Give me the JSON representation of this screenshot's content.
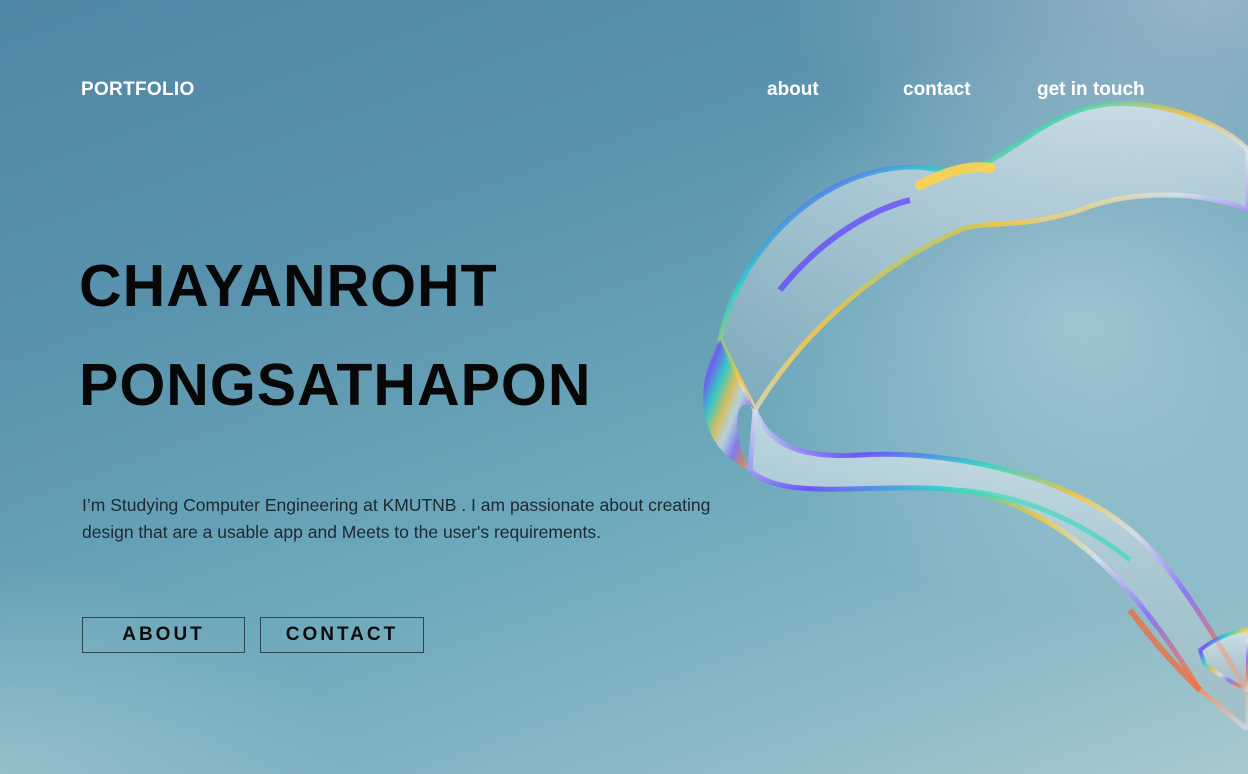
{
  "nav": {
    "logo": "PORTFOLIO",
    "links": [
      "about",
      "contact",
      "get in touch"
    ]
  },
  "hero": {
    "first_name": "CHAYANROHT",
    "last_name": "PONGSATHAPON",
    "description": "I’m Studying Computer Engineering at KMUTNB . I am passionate about creating design that are a usable app and Meets to the user's requirements.",
    "buttons": {
      "about": "ABOUT",
      "contact": "CONTACT"
    }
  },
  "colors": {
    "background": "#5a93ad",
    "text_dark": "#070707",
    "nav_text": "#ffffff"
  },
  "decorative": {
    "graphic": "iridescent-glass-ribbon"
  }
}
